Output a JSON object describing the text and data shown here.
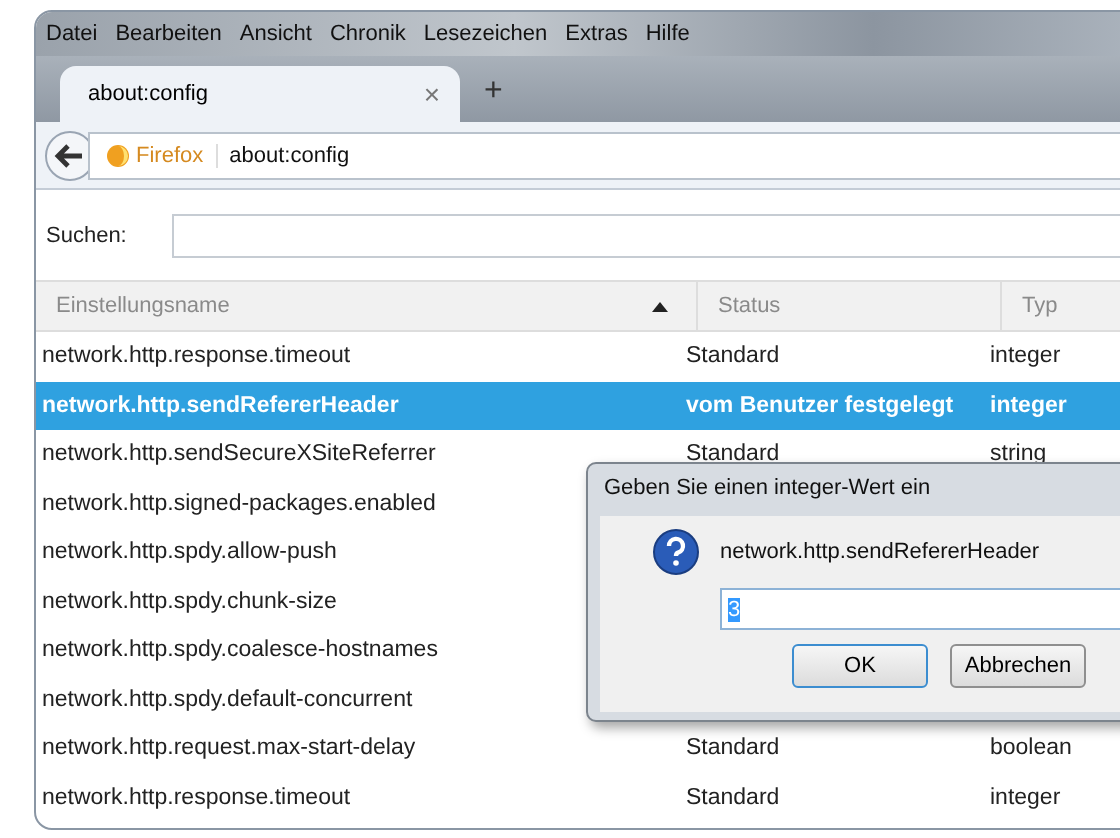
{
  "menu": [
    "Datei",
    "Bearbeiten",
    "Ansicht",
    "Chronik",
    "Lesezeichen",
    "Extras",
    "Hilfe"
  ],
  "tabs": [
    {
      "label": "about:config",
      "selected": true,
      "close": "×"
    }
  ],
  "new_tab": "+",
  "address": {
    "identity": "Firefox",
    "url": "about:config"
  },
  "search": {
    "label": "Suchen:"
  },
  "columns": [
    {
      "label": "Einstellungsname",
      "sorted": true
    },
    {
      "label": "Status",
      "sorted": false
    },
    {
      "label": "Typ",
      "sorted": false
    }
  ],
  "rows": [
    {
      "name": "network.http.response.timeout",
      "status": "Standard",
      "type": "integer",
      "selected": false
    },
    {
      "name": "network.http.sendRefererHeader",
      "status": "vom Benutzer festgelegt",
      "type": "integer",
      "selected": true
    },
    {
      "name": "network.http.sendSecureXSiteReferrer",
      "status": "Standard",
      "type": "string",
      "selected": false
    },
    {
      "name": "network.http.signed-packages.enabled",
      "selected": false
    },
    {
      "name": "network.http.spdy.allow-push",
      "selected": false
    },
    {
      "name": "network.http.spdy.chunk-size",
      "selected": false
    },
    {
      "name": "network.http.spdy.coalesce-hostnames",
      "selected": false
    },
    {
      "name": "network.http.spdy.default-concurrent",
      "selected": false
    },
    {
      "name": "network.http.request.max-start-delay",
      "status": "Standard",
      "type": "boolean",
      "selected": false
    },
    {
      "name": "network.http.response.timeout",
      "status": "Standard",
      "type": "integer",
      "selected": false
    }
  ],
  "dialog": {
    "title": "Geben Sie einen integer-Wert ein",
    "prompt": "network.http.sendRefererHeader",
    "value": "3",
    "buttons": [
      {
        "label": "OK",
        "default": true
      },
      {
        "label": "Abbrechen",
        "default": false
      }
    ]
  }
}
